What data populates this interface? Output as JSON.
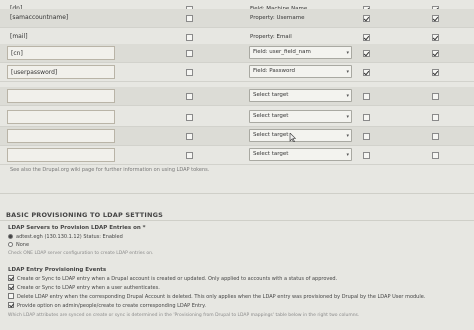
{
  "mapping_table": {
    "rows": [
      {
        "source": "[dn]",
        "boxed": false,
        "c1": false,
        "target_type": "text",
        "target": "Field: Machine Name",
        "c2": true,
        "c3": true
      },
      {
        "source": "[samaccountname]",
        "boxed": false,
        "c1": false,
        "target_type": "text",
        "target": "Property: Username",
        "c2": true,
        "c3": true
      },
      {
        "source": "[mail]",
        "boxed": false,
        "c1": false,
        "target_type": "text",
        "target": "Property: Email",
        "c2": true,
        "c3": true
      },
      {
        "source": "[cn]",
        "boxed": true,
        "c1": false,
        "target_type": "select",
        "target": "Field: user_field_nam",
        "c2": true,
        "c3": true
      },
      {
        "source": "[userpassword]",
        "boxed": true,
        "c1": false,
        "target_type": "select",
        "target": "Field: Password",
        "c2": true,
        "c3": true
      },
      {
        "source": "",
        "boxed": true,
        "c1": false,
        "target_type": "select",
        "target": "Select target",
        "c2": false,
        "c3": false
      },
      {
        "source": "",
        "boxed": true,
        "c1": false,
        "target_type": "select",
        "target": "Select target",
        "c2": false,
        "c3": false
      },
      {
        "source": "",
        "boxed": true,
        "c1": false,
        "target_type": "select",
        "target": "Select target",
        "c2": false,
        "c3": false
      },
      {
        "source": "",
        "boxed": true,
        "c1": false,
        "target_type": "select",
        "target": "Select target",
        "c2": false,
        "c3": false
      }
    ],
    "help_text": "See also the Drupal.org wiki page for further information on using LDAP tokens."
  },
  "provisioning": {
    "title": "BASIC PROVISIONING TO LDAP SETTINGS",
    "servers_label": "LDAP Servers to Provision LDAP Entries on *",
    "server_option": "adtest.egh (130.130.1.12) Status: Enabled",
    "none_option": "None",
    "servers_help": "Check ONE LDAP server configuration to create LDAP entries on.",
    "events_label": "LDAP Entry Provisioning Events",
    "events": [
      {
        "label": "Create or Sync to LDAP entry when a Drupal account is created or updated. Only applied to accounts with a status of approved.",
        "checked": true
      },
      {
        "label": "Create or Sync to LDAP entry when a user authenticates.",
        "checked": true
      },
      {
        "label": "Delete LDAP entry when the corresponding Drupal Account is deleted. This only applies when the LDAP entry was provisioned by Drupal by the LDAP User module.",
        "checked": false
      },
      {
        "label": "Provide option on admin/people/create to create corresponding LDAP Entry.",
        "checked": true
      }
    ],
    "events_help": "Which LDAP attributes are synced on create or sync is determined in the 'Provisioning from Drupal to LDAP mappings' table below in the right two columns."
  }
}
